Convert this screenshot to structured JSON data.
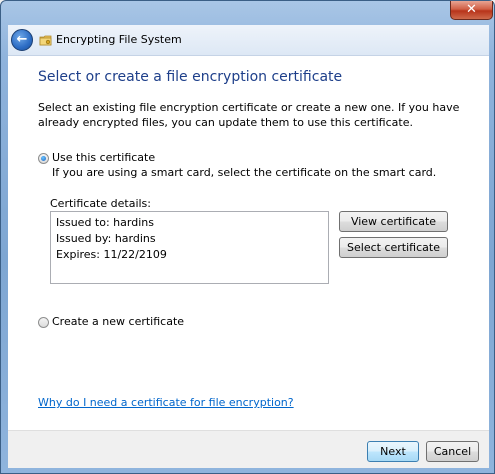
{
  "window": {
    "title": "Encrypting File System",
    "close_glyph": "✕"
  },
  "header": {
    "back_glyph": "←"
  },
  "page": {
    "title": "Select or create a file encryption certificate",
    "description": "Select an existing file encryption certificate or create a new one. If you have already encrypted files, you can update them to use this certificate."
  },
  "options": {
    "use_existing": {
      "label": "Use this certificate",
      "selected": true,
      "hint": "If you are using a smart card, select the certificate on the smart card."
    },
    "create_new": {
      "label": "Create a new certificate",
      "selected": false
    }
  },
  "certificate": {
    "details_label": "Certificate details:",
    "issued_to": "Issued to: hardins",
    "issued_by": "Issued by: hardins",
    "expires": "Expires: 11/22/2109"
  },
  "buttons": {
    "view": "View certificate",
    "select": "Select certificate",
    "next": "Next",
    "cancel": "Cancel"
  },
  "help_link": "Why do I need a certificate for file encryption?"
}
